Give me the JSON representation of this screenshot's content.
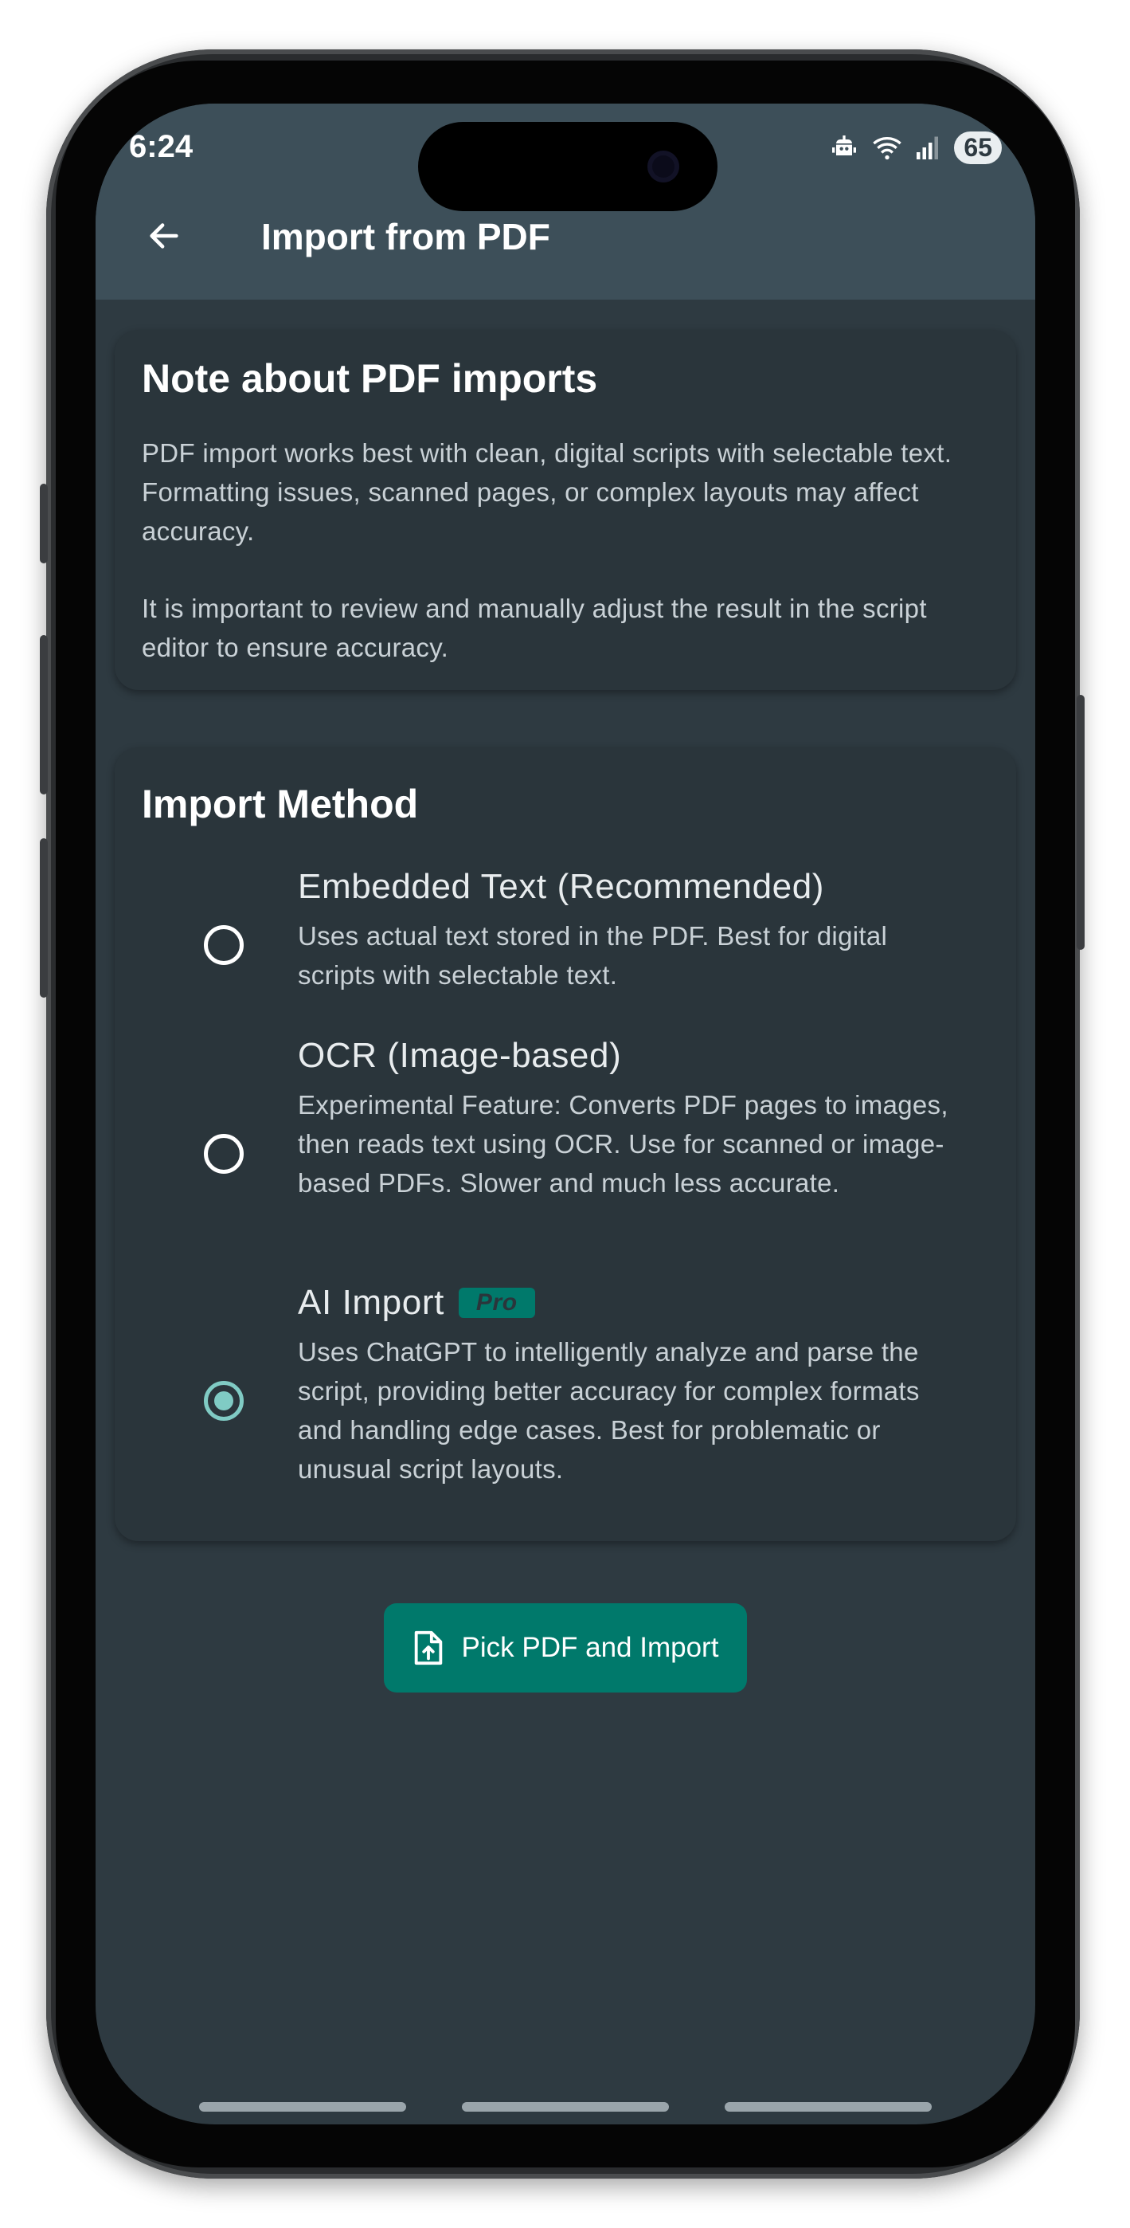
{
  "status_bar": {
    "time": "6:24",
    "battery": "65"
  },
  "app_bar": {
    "title": "Import from PDF"
  },
  "note_card": {
    "title": "Note about PDF imports",
    "paragraph1": "PDF import works best with clean, digital scripts with selectable text. Formatting issues, scanned pages, or complex layouts may affect accuracy.",
    "paragraph2": "It is important to review and manually adjust the result in the script editor to ensure accuracy."
  },
  "method_card": {
    "title": "Import Method",
    "options": [
      {
        "title": "Embedded Text (Recommended)",
        "description": "Uses actual text stored in the PDF. Best for digital scripts with selectable text.",
        "selected": false
      },
      {
        "title": "OCR (Image-based)",
        "description": "Experimental Feature: Converts PDF pages to images, then reads text using OCR. Use for scanned or image-based PDFs. Slower and much less accurate.",
        "selected": false
      },
      {
        "title": "AI Import",
        "badge": "Pro",
        "description": "Uses ChatGPT to intelligently analyze and parse the script, providing better accuracy for complex formats and handling edge cases. Best for problematic or unusual script layouts.",
        "selected": true
      }
    ]
  },
  "primary_button": {
    "label": "Pick PDF and Import",
    "icon": "file-upload-icon"
  },
  "colors": {
    "app_bar": "#3d4f59",
    "background": "#2e3a41",
    "card": "#2a353b",
    "accent": "#00796b",
    "radio_selected": "#80cbc4"
  }
}
